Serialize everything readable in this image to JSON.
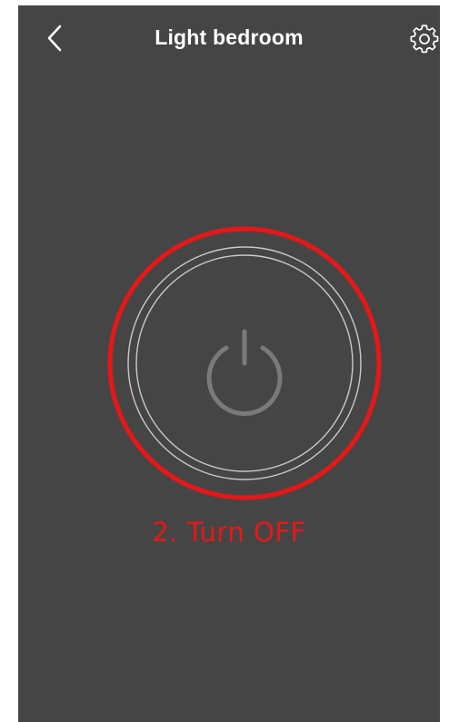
{
  "header": {
    "title": "Light bedroom",
    "back_icon": "chevron-left-icon",
    "settings_icon": "gear-icon"
  },
  "power": {
    "icon": "power-icon",
    "state": "off"
  },
  "annotation": {
    "label": "2. Turn OFF",
    "color": "#e81717"
  },
  "colors": {
    "background": "#464545",
    "ring": "#c9c9c9",
    "power_icon": "#7a7a7a",
    "text": "#ffffff"
  }
}
